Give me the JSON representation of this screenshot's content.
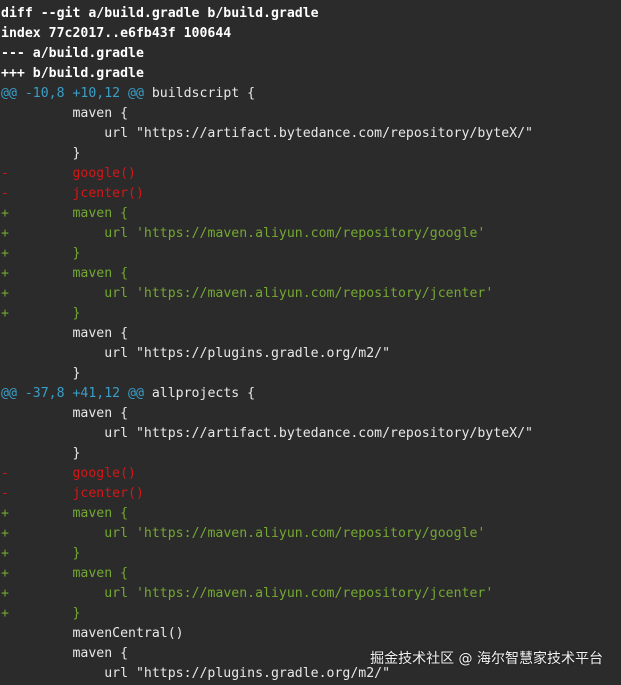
{
  "colors": {
    "background": "#2b2b2b",
    "text": "#e8e8e8",
    "hunk": "#3a9ec7",
    "deleted": "#d01818",
    "added": "#74a832"
  },
  "diff": {
    "lines": [
      {
        "type": "meta",
        "text": "diff --git a/build.gradle b/build.gradle"
      },
      {
        "type": "meta",
        "text": "index 77c2017..e6fb43f 100644"
      },
      {
        "type": "meta",
        "text": "--- a/build.gradle"
      },
      {
        "type": "meta",
        "text": "+++ b/build.gradle"
      },
      {
        "type": "hunk",
        "range": "@@ -10,8 +10,12 @@",
        "context": " buildscript {"
      },
      {
        "type": "ctx",
        "text": "         maven {"
      },
      {
        "type": "ctx",
        "text": "             url \"https://artifact.bytedance.com/repository/byteX/\""
      },
      {
        "type": "ctx",
        "text": "         }"
      },
      {
        "type": "del",
        "sign": "-",
        "text": "        google()"
      },
      {
        "type": "del",
        "sign": "-",
        "text": "        jcenter()"
      },
      {
        "type": "add",
        "sign": "+",
        "text": "        maven {"
      },
      {
        "type": "add",
        "sign": "+",
        "text": "            url 'https://maven.aliyun.com/repository/google'"
      },
      {
        "type": "add",
        "sign": "+",
        "text": "        }"
      },
      {
        "type": "add",
        "sign": "+",
        "text": "        maven {"
      },
      {
        "type": "add",
        "sign": "+",
        "text": "            url 'https://maven.aliyun.com/repository/jcenter'"
      },
      {
        "type": "add",
        "sign": "+",
        "text": "        }"
      },
      {
        "type": "ctx",
        "text": "         maven {"
      },
      {
        "type": "ctx",
        "text": "             url \"https://plugins.gradle.org/m2/\""
      },
      {
        "type": "ctx",
        "text": "         }"
      },
      {
        "type": "hunk",
        "range": "@@ -37,8 +41,12 @@",
        "context": " allprojects {"
      },
      {
        "type": "ctx",
        "text": "         maven {"
      },
      {
        "type": "ctx",
        "text": "             url \"https://artifact.bytedance.com/repository/byteX/\""
      },
      {
        "type": "ctx",
        "text": "         }"
      },
      {
        "type": "del",
        "sign": "-",
        "text": "        google()"
      },
      {
        "type": "del",
        "sign": "-",
        "text": "        jcenter()"
      },
      {
        "type": "add",
        "sign": "+",
        "text": "        maven {"
      },
      {
        "type": "add",
        "sign": "+",
        "text": "            url 'https://maven.aliyun.com/repository/google'"
      },
      {
        "type": "add",
        "sign": "+",
        "text": "        }"
      },
      {
        "type": "add",
        "sign": "+",
        "text": "        maven {"
      },
      {
        "type": "add",
        "sign": "+",
        "text": "            url 'https://maven.aliyun.com/repository/jcenter'"
      },
      {
        "type": "add",
        "sign": "+",
        "text": "        }"
      },
      {
        "type": "ctx",
        "text": "         mavenCentral()"
      },
      {
        "type": "ctx",
        "text": "         maven {"
      },
      {
        "type": "ctx",
        "text": "             url \"https://plugins.gradle.org/m2/\""
      }
    ]
  },
  "watermark": "掘金技术社区 @ 海尔智慧家技术平台"
}
